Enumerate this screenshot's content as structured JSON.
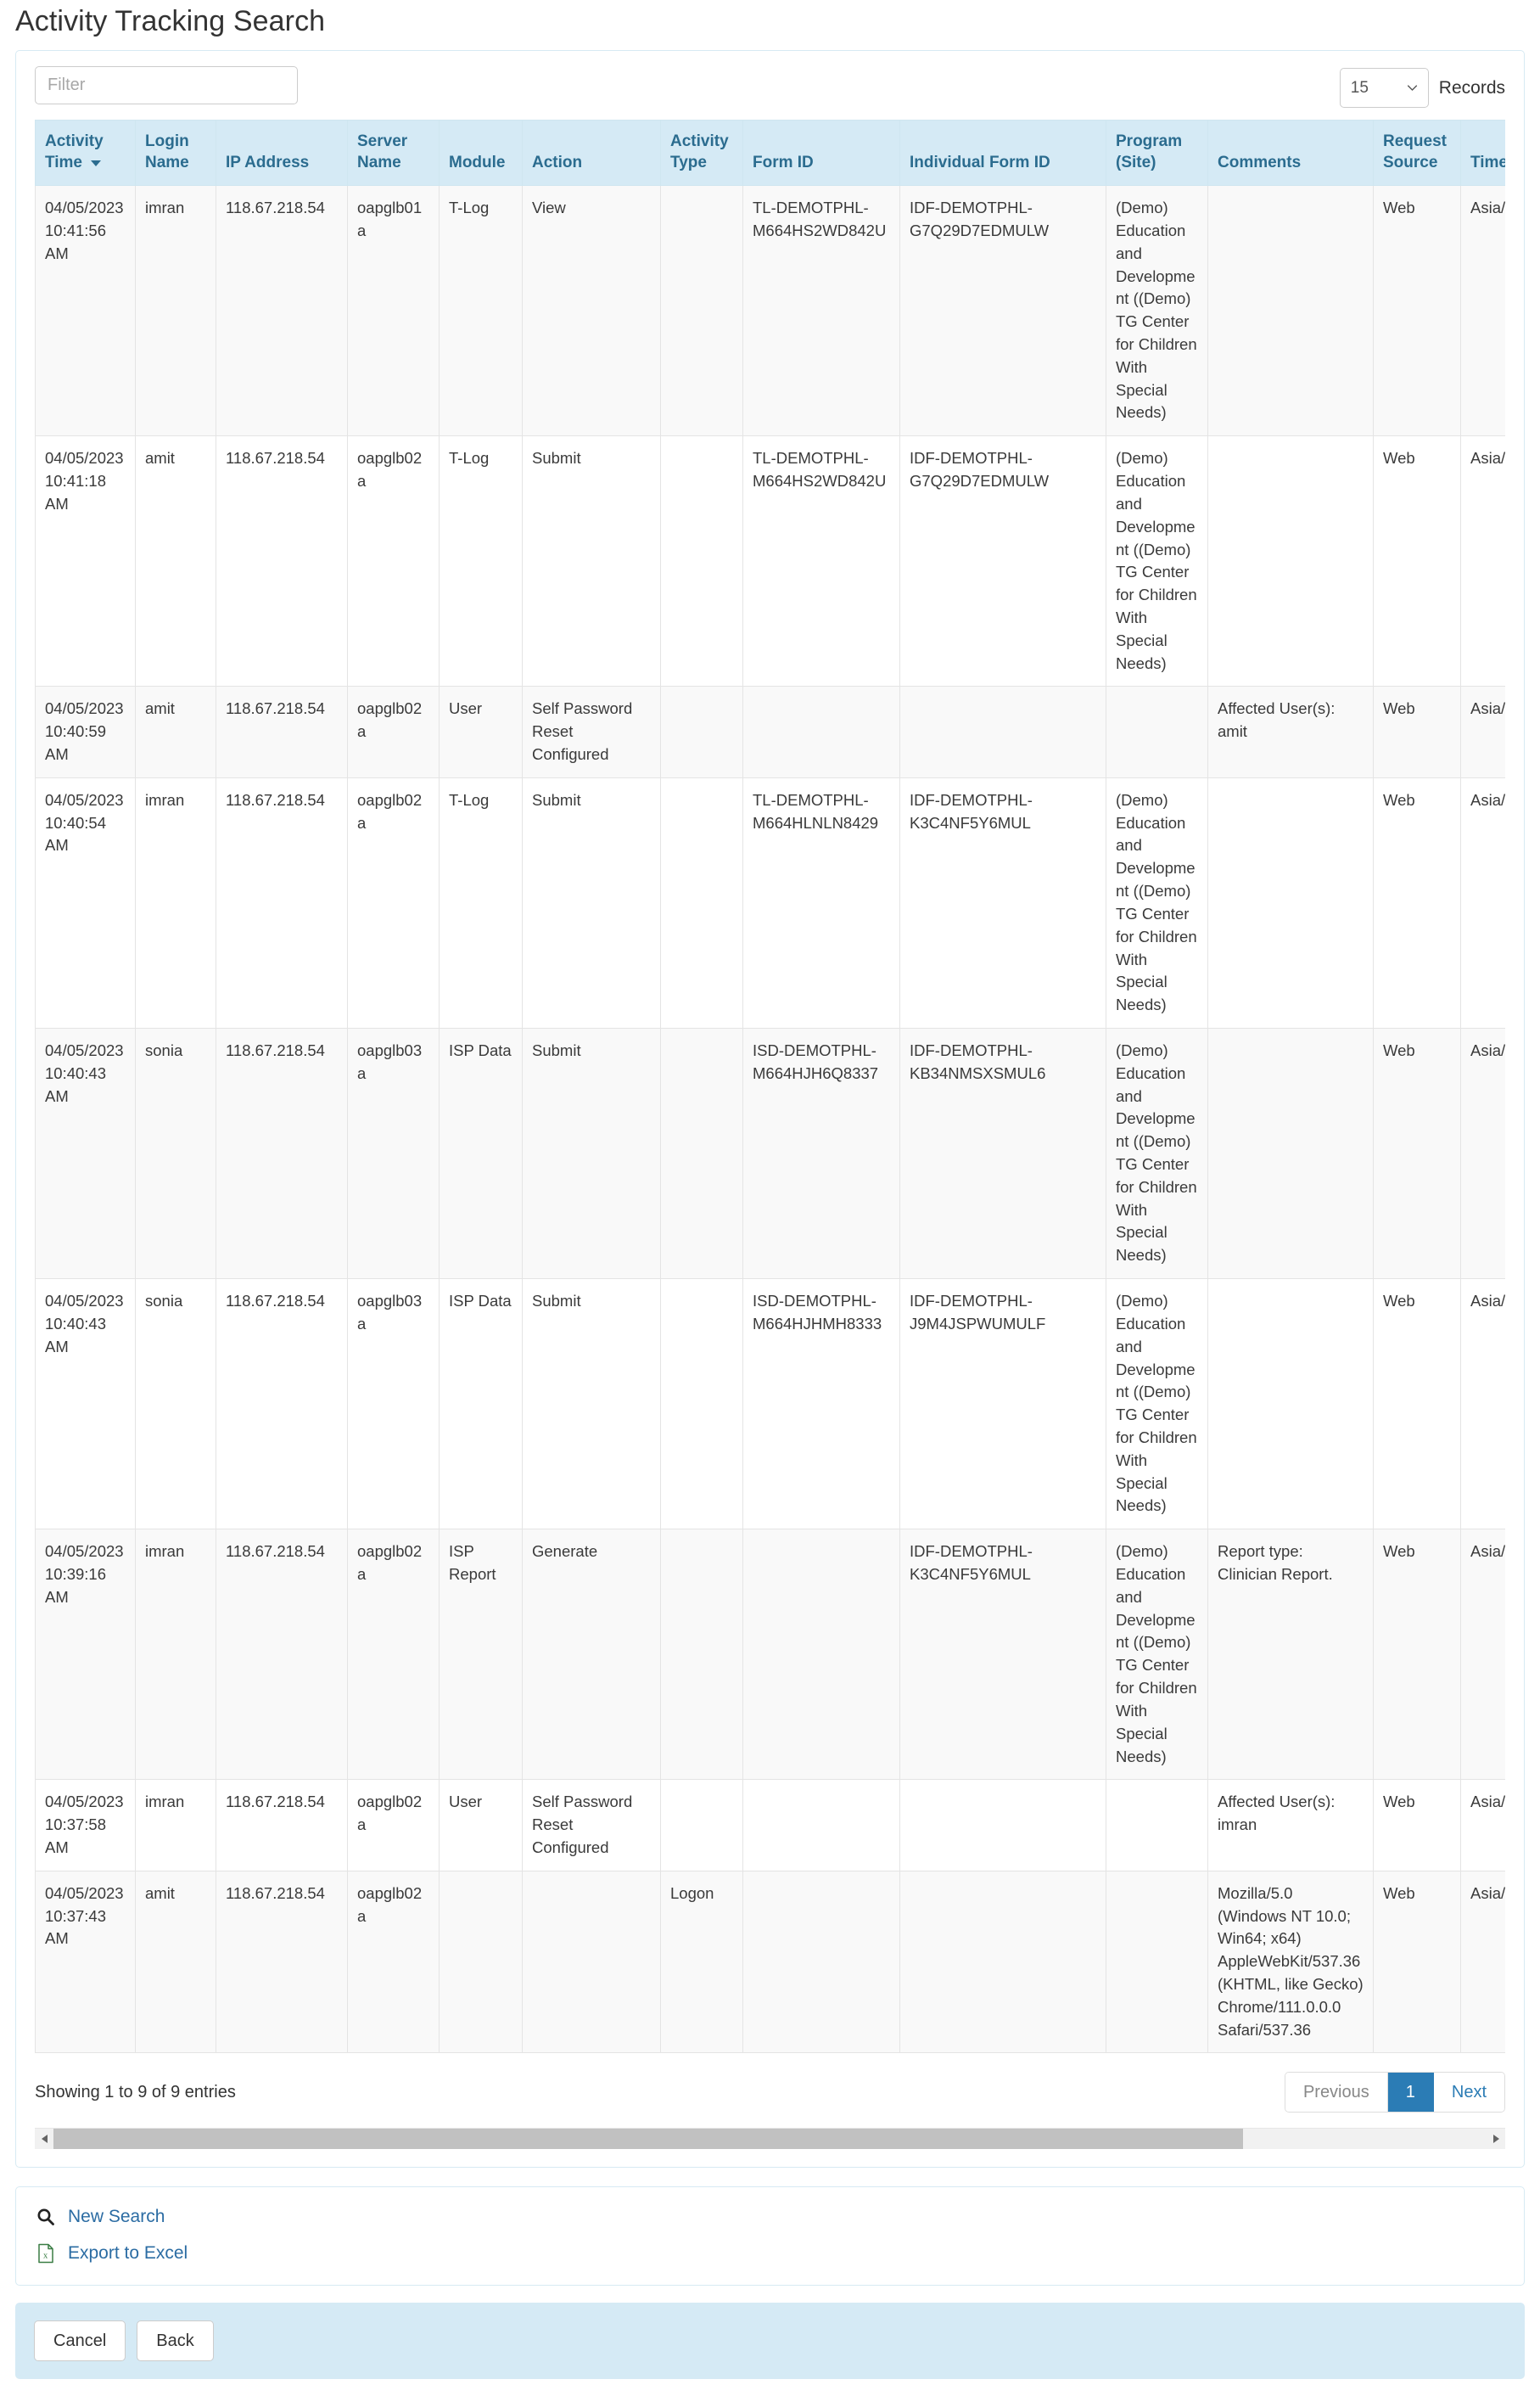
{
  "page": {
    "title": "Activity Tracking Search"
  },
  "toolbar": {
    "filter_placeholder": "Filter",
    "filter_value": "",
    "records_value": "15",
    "records_label": "Records"
  },
  "table": {
    "columns": [
      {
        "key": "activity_time",
        "label": "Activity Time",
        "sorted": true,
        "sort_dir": "desc"
      },
      {
        "key": "login_name",
        "label": "Login Name",
        "sorted": false
      },
      {
        "key": "ip_address",
        "label": "IP Address",
        "sorted": false
      },
      {
        "key": "server_name",
        "label": "Server Name",
        "sorted": false
      },
      {
        "key": "module",
        "label": "Module",
        "sorted": false
      },
      {
        "key": "action",
        "label": "Action",
        "sorted": false
      },
      {
        "key": "activity_type",
        "label": "Activity Type",
        "sorted": false
      },
      {
        "key": "form_id",
        "label": "Form ID",
        "sorted": false
      },
      {
        "key": "individual_form_id",
        "label": "Individual Form ID",
        "sorted": false
      },
      {
        "key": "program_site",
        "label": "Program (Site)",
        "sorted": false
      },
      {
        "key": "comments",
        "label": "Comments",
        "sorted": false
      },
      {
        "key": "request_source",
        "label": "Request Source",
        "sorted": false
      },
      {
        "key": "time_zone",
        "label": "Time Zone",
        "sorted": false
      }
    ],
    "rows": [
      {
        "activity_time": "04/05/2023 10:41:56 AM",
        "login_name": "imran",
        "ip_address": "118.67.218.54",
        "server_name": "oapglb01a",
        "module": "T-Log",
        "action": "View",
        "activity_type": "",
        "form_id": "TL-DEMOTPHL-M664HS2WD842U",
        "individual_form_id": "IDF-DEMOTPHL-G7Q29D7EDMULW",
        "program_site": "(Demo) Education and Development ((Demo) TG Center for Children With Special Needs)",
        "comments": "",
        "request_source": "Web",
        "time_zone": "Asia/Manila"
      },
      {
        "activity_time": "04/05/2023 10:41:18 AM",
        "login_name": "amit",
        "ip_address": "118.67.218.54",
        "server_name": "oapglb02a",
        "module": "T-Log",
        "action": "Submit",
        "activity_type": "",
        "form_id": "TL-DEMOTPHL-M664HS2WD842U",
        "individual_form_id": "IDF-DEMOTPHL-G7Q29D7EDMULW",
        "program_site": "(Demo) Education and Development ((Demo) TG Center for Children With Special Needs)",
        "comments": "",
        "request_source": "Web",
        "time_zone": "Asia/Manila"
      },
      {
        "activity_time": "04/05/2023 10:40:59 AM",
        "login_name": "amit",
        "ip_address": "118.67.218.54",
        "server_name": "oapglb02a",
        "module": "User",
        "action": "Self Password Reset Configured",
        "activity_type": "",
        "form_id": "",
        "individual_form_id": "",
        "program_site": "",
        "comments": "Affected User(s): amit",
        "request_source": "Web",
        "time_zone": "Asia/Manila"
      },
      {
        "activity_time": "04/05/2023 10:40:54 AM",
        "login_name": "imran",
        "ip_address": "118.67.218.54",
        "server_name": "oapglb02a",
        "module": "T-Log",
        "action": "Submit",
        "activity_type": "",
        "form_id": "TL-DEMOTPHL-M664HLNLN8429",
        "individual_form_id": "IDF-DEMOTPHL-K3C4NF5Y6MUL",
        "program_site": "(Demo) Education and Development ((Demo) TG Center for Children With Special Needs)",
        "comments": "",
        "request_source": "Web",
        "time_zone": "Asia/Manila"
      },
      {
        "activity_time": "04/05/2023 10:40:43 AM",
        "login_name": "sonia",
        "ip_address": "118.67.218.54",
        "server_name": "oapglb03a",
        "module": "ISP Data",
        "action": "Submit",
        "activity_type": "",
        "form_id": "ISD-DEMOTPHL-M664HJH6Q8337",
        "individual_form_id": "IDF-DEMOTPHL-KB34NMSXSMUL6",
        "program_site": "(Demo) Education and Development ((Demo) TG Center for Children With Special Needs)",
        "comments": "",
        "request_source": "Web",
        "time_zone": "Asia/Manila"
      },
      {
        "activity_time": "04/05/2023 10:40:43 AM",
        "login_name": "sonia",
        "ip_address": "118.67.218.54",
        "server_name": "oapglb03a",
        "module": "ISP Data",
        "action": "Submit",
        "activity_type": "",
        "form_id": "ISD-DEMOTPHL-M664HJHMH8333",
        "individual_form_id": "IDF-DEMOTPHL-J9M4JSPWUMULF",
        "program_site": "(Demo) Education and Development ((Demo) TG Center for Children With Special Needs)",
        "comments": "",
        "request_source": "Web",
        "time_zone": "Asia/Manila"
      },
      {
        "activity_time": "04/05/2023 10:39:16 AM",
        "login_name": "imran",
        "ip_address": "118.67.218.54",
        "server_name": "oapglb02a",
        "module": "ISP Report",
        "action": "Generate",
        "activity_type": "",
        "form_id": "",
        "individual_form_id": "IDF-DEMOTPHL-K3C4NF5Y6MUL",
        "program_site": "(Demo) Education and Development ((Demo) TG Center for Children With Special Needs)",
        "comments": "Report type: Clinician Report.",
        "request_source": "Web",
        "time_zone": "Asia/Manila"
      },
      {
        "activity_time": "04/05/2023 10:37:58 AM",
        "login_name": "imran",
        "ip_address": "118.67.218.54",
        "server_name": "oapglb02a",
        "module": "User",
        "action": "Self Password Reset Configured",
        "activity_type": "",
        "form_id": "",
        "individual_form_id": "",
        "program_site": "",
        "comments": "Affected User(s): imran",
        "request_source": "Web",
        "time_zone": "Asia/Manila"
      },
      {
        "activity_time": "04/05/2023 10:37:43 AM",
        "login_name": "amit",
        "ip_address": "118.67.218.54",
        "server_name": "oapglb02a",
        "module": "",
        "action": "",
        "activity_type": "Logon",
        "form_id": "",
        "individual_form_id": "",
        "program_site": "",
        "comments": "Mozilla/5.0 (Windows NT 10.0; Win64; x64) AppleWebKit/537.36 (KHTML, like Gecko) Chrome/111.0.0.0 Safari/537.36",
        "request_source": "Web",
        "time_zone": "Asia/Manila"
      }
    ]
  },
  "footer": {
    "showing_text": "Showing 1 to 9 of 9 entries",
    "pagination": {
      "previous_label": "Previous",
      "page_label": "1",
      "next_label": "Next"
    }
  },
  "links": [
    {
      "icon": "search-icon",
      "label": "New Search"
    },
    {
      "icon": "excel-file-icon",
      "label": "Export to Excel"
    }
  ],
  "actions": {
    "cancel_label": "Cancel",
    "back_label": "Back"
  },
  "colors": {
    "header_bg": "#d5eaf5",
    "header_text": "#2b6c8f",
    "link": "#2b6ca3",
    "active_page": "#2b7cb5",
    "action_bar_bg": "#d5eaf5",
    "excel_green": "#3a7d44"
  }
}
